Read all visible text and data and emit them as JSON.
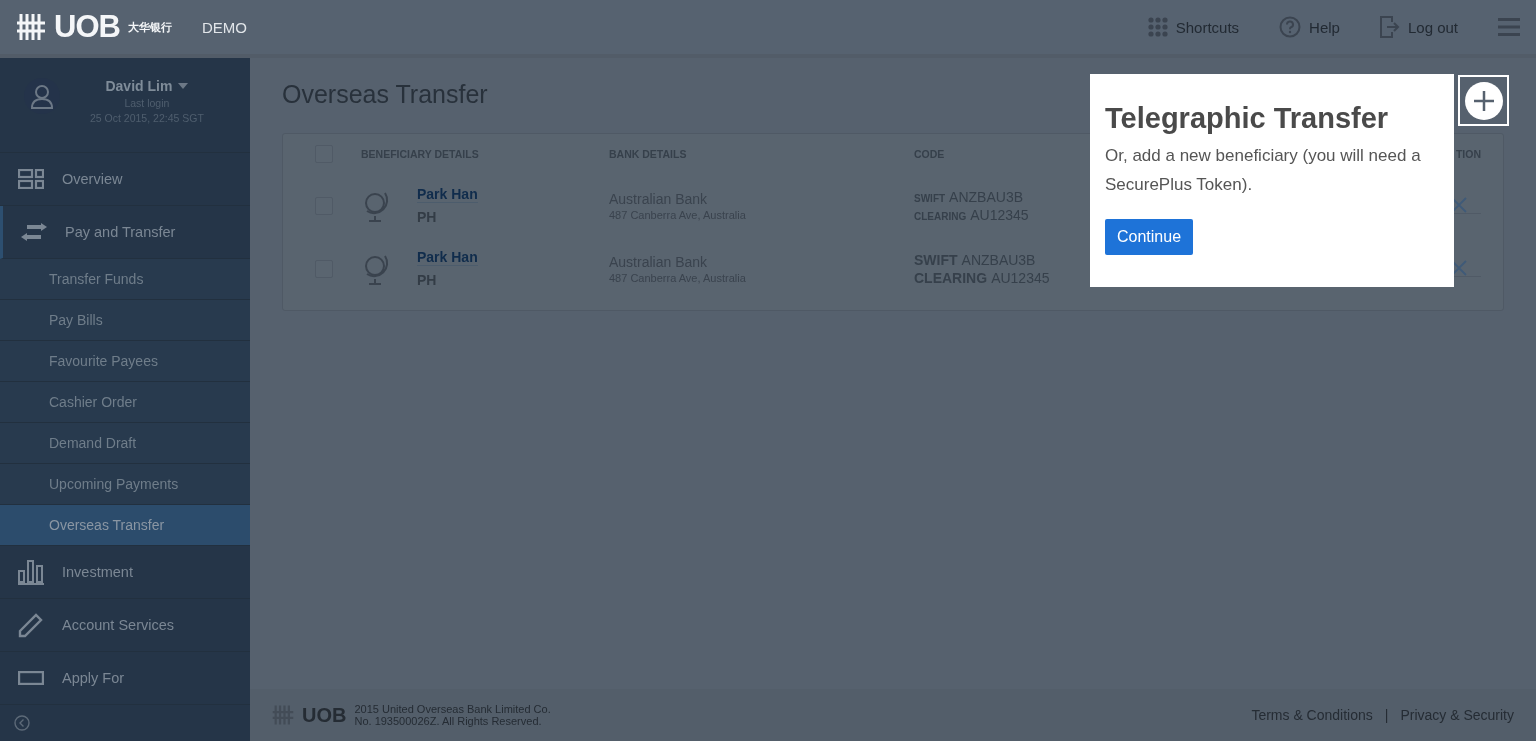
{
  "header": {
    "logo": "UOB",
    "logo_chinese": "大华银行",
    "badge": "DEMO",
    "actions": [
      {
        "kind": "shortcuts",
        "label": "Shortcuts"
      },
      {
        "kind": "help",
        "label": "Help"
      },
      {
        "kind": "logout",
        "label": "Log out"
      }
    ]
  },
  "user": {
    "name": "David Lim",
    "last_login_label": "Last login",
    "last_login": "25 Oct 2015, 22:45 SGT"
  },
  "sidebar": {
    "items": [
      {
        "kind": "overview",
        "label": "Overview",
        "expanded": false
      },
      {
        "kind": "transfer",
        "label": "Pay and Transfer",
        "expanded": true,
        "children": [
          {
            "label": "Transfer Funds",
            "selected": false
          },
          {
            "label": "Pay Bills",
            "selected": false
          },
          {
            "label": "Favourite Payees",
            "selected": false
          },
          {
            "label": "Cashier Order",
            "selected": false
          },
          {
            "label": "Demand Draft",
            "selected": false
          },
          {
            "label": "Upcoming Payments",
            "selected": false
          },
          {
            "label": "Overseas Transfer",
            "selected": true
          }
        ]
      },
      {
        "kind": "investment",
        "label": "Investment",
        "expanded": false
      },
      {
        "kind": "services",
        "label": "Account Services",
        "expanded": false
      },
      {
        "kind": "apply",
        "label": "Apply For",
        "expanded": false
      }
    ]
  },
  "page": {
    "title": "Overseas Transfer"
  },
  "table": {
    "select_all_checked": false,
    "columns": [
      "BENEFICIARY DETAILS",
      "BANK DETAILS",
      "CODE",
      "TION"
    ],
    "rows": [
      {
        "name": "Park Han",
        "initials": "PH",
        "bank": "Australian Bank",
        "address": "487 Canberra Ave, Australia",
        "swift_label": "SWIFT",
        "swift": "ANZBAU3B",
        "clearing_label": "CLEARING",
        "clearing": "AU12345",
        "emphasized": false,
        "checked": false
      },
      {
        "name": "Park Han",
        "initials": "PH",
        "bank": "Australian Bank",
        "address": "487 Canberra Ave, Australia",
        "swift_label": "SWIFT",
        "swift": "ANZBAU3B",
        "clearing_label": "CLEARING",
        "clearing": "AU12345",
        "emphasized": true,
        "checked": false
      }
    ]
  },
  "popup": {
    "title": "Telegraphic Transfer",
    "text": "Or, add a new beneficiary (you will need a SecurePlus Token).",
    "button": "Continue"
  },
  "footer": {
    "logo": "UOB",
    "copyright": "2015 United Overseas Bank Limited Co.",
    "registration": "No. 193500026Z. All Rights Reserved.",
    "links": [
      "Terms & Conditions",
      "Privacy & Security"
    ],
    "separator": "|"
  }
}
